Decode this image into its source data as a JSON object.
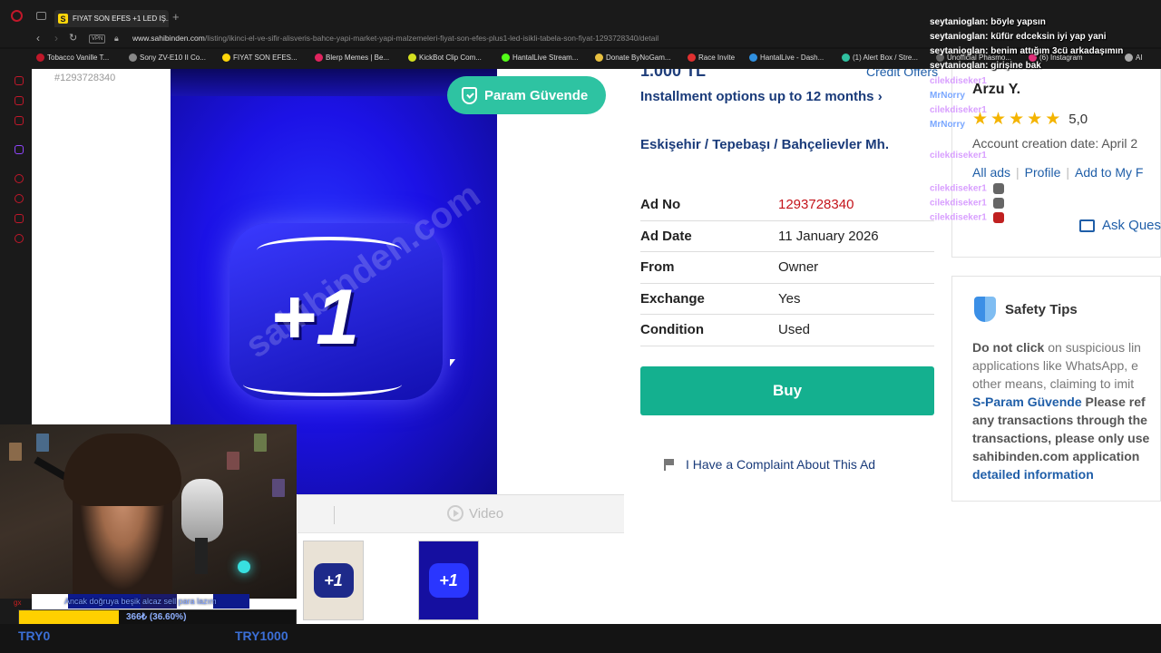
{
  "browser": {
    "tab_title": "FIYAT SON EFES +1 LED IŞ...",
    "tab_favicon": "S",
    "url_domain": "www.sahibinden.com",
    "url_path": "/listing/ikinci-el-ve-sifir-alisveris-bahce-yapi-market-yapi-malzemeleri-fiyat-son-efes-plus1-led-isikli-tabela-son-fiyat-1293728340/detail",
    "vpn_label": "VPN",
    "bookmarks": [
      {
        "label": "Tobacco Vanille T...",
        "color": "#c0182a"
      },
      {
        "label": "Sony ZV-E10 II Co...",
        "color": "#888888"
      },
      {
        "label": "FIYAT SON EFES...",
        "color": "#ffd60a"
      },
      {
        "label": "Blerp Memes | Be...",
        "color": "#e0245e"
      },
      {
        "label": "KickBot Clip Com...",
        "color": "#d4e020"
      },
      {
        "label": "HantalLive Stream...",
        "color": "#53fc18"
      },
      {
        "label": "Donate ByNoGam...",
        "color": "#e8c040"
      },
      {
        "label": "Race Invite",
        "color": "#e03030"
      },
      {
        "label": "HantalLive - Dash...",
        "color": "#3090e0"
      },
      {
        "label": "(1) Alert Box / Stre...",
        "color": "#30c0a0"
      },
      {
        "label": "Unofficial Phasmo...",
        "color": "#666666"
      },
      {
        "label": "(6) Instagram",
        "color": "#e0307a"
      },
      {
        "label": "AI",
        "color": "#aaaaaa"
      }
    ]
  },
  "listing": {
    "ad_no_small": "#1293728340",
    "param_badge": "Param Güvende",
    "watermark": "sahibinden.com",
    "badge_text": "+1",
    "video_label": "Video",
    "price": "1.000 TL",
    "credit_offers": "Credit Offers",
    "installment": "Installment options up to 12 months",
    "location": "Eskişehir  /  Tepebaşı  /  Bahçelievler Mh.",
    "details": [
      {
        "key": "Ad No",
        "value": "1293728340"
      },
      {
        "key": "Ad Date",
        "value": "11 January 2026"
      },
      {
        "key": "From",
        "value": "Owner"
      },
      {
        "key": "Exchange",
        "value": "Yes"
      },
      {
        "key": "Condition",
        "value": "Used"
      }
    ],
    "buy_label": "Buy",
    "complaint_label": "I Have a Complaint About This Ad"
  },
  "seller": {
    "name": "Arzu Y.",
    "rating": "5,0",
    "stars": 5,
    "account_creation": "Account creation date: April 2",
    "links": [
      "All ads",
      "Profile",
      "Add to My F"
    ],
    "ask_question": "Ask Ques"
  },
  "safety": {
    "title": "Safety Tips",
    "do_not_click": "Do not click",
    "line1": " on suspicious lin",
    "line2": "applications like WhatsApp, e",
    "line3": "other means, claiming to imit",
    "sparam": "S-Param Güvende",
    "line4": " Please ref",
    "line5": "any transactions through the",
    "line6": "transactions, please only use",
    "line7": "sahibinden.com application",
    "line8": "detailed information"
  },
  "chat": [
    {
      "user": "seytanioglan:",
      "msg": "böyle yapsın",
      "color": "#ffffff"
    },
    {
      "user": "seytanioglan:",
      "msg": "küfür edceksin iyi yap yani",
      "color": "#ffffff"
    },
    {
      "user": "seytanioglan:",
      "msg": "benim attığım 3cü arkadaşımın",
      "color": "#ffffff"
    },
    {
      "user": "seytanioglan:",
      "msg": "girişine bak",
      "color": "#ffffff"
    },
    {
      "user": "cilekdiseker1",
      "msg": "",
      "color": "#d9a0ff"
    },
    {
      "user": "MrNorry",
      "msg": "",
      "color": "#7aa7ff"
    },
    {
      "user": "cilekdiseker1",
      "msg": "",
      "color": "#d9a0ff"
    },
    {
      "user": "MrNorry",
      "msg": "",
      "color": "#7aa7ff"
    },
    {
      "user": "cilekdiseker1",
      "msg": "",
      "color": "#d9a0ff"
    },
    {
      "user": "cilekdiseker1",
      "msg": "",
      "color": "#d9a0ff"
    },
    {
      "user": "cilekdiseker1",
      "msg": "",
      "color": "#d9a0ff"
    },
    {
      "user": "cilekdiseker1",
      "msg": "",
      "color": "#d9a0ff"
    }
  ],
  "stream": {
    "ticker_text": "Ancak doğruya beşik alcaz sell para lazım",
    "gx": "gx",
    "goal_text": "366₺ (36.60%)",
    "goal_progress": 0.366,
    "goal_start": "TRY0",
    "goal_end": "TRY1000"
  }
}
